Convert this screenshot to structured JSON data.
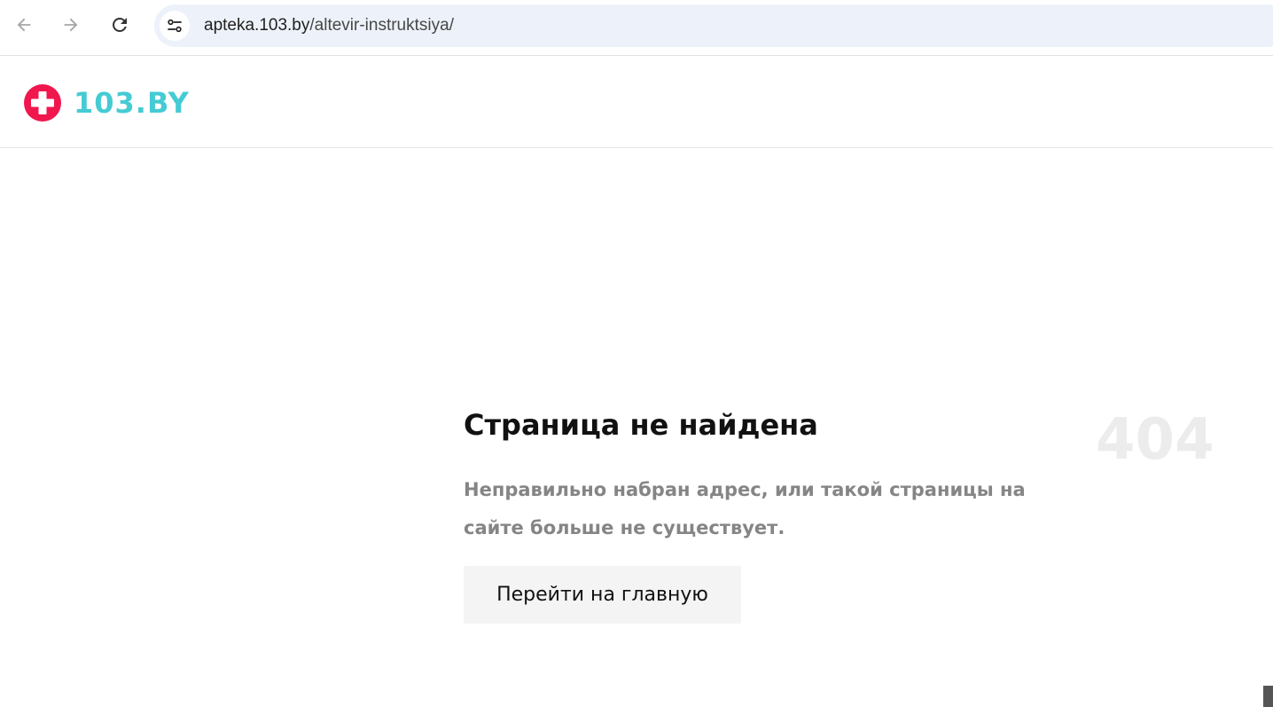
{
  "browser": {
    "url_domain": "apteka.103.by",
    "url_path": "/altevir-instruktsiya/",
    "icons": {
      "back": "arrow-left-icon",
      "forward": "arrow-right-icon",
      "reload": "reload-icon",
      "site_info": "tune-icon"
    }
  },
  "site": {
    "logo_text": "103.BY",
    "colors": {
      "brand_red": "#f0174e",
      "brand_teal": "#45cbd4"
    }
  },
  "error": {
    "title": "Страница не найдена",
    "code": "404",
    "description": "Неправильно набран адрес, или такой страницы на сайте больше не существует.",
    "home_button_label": "Перейти на главную"
  }
}
